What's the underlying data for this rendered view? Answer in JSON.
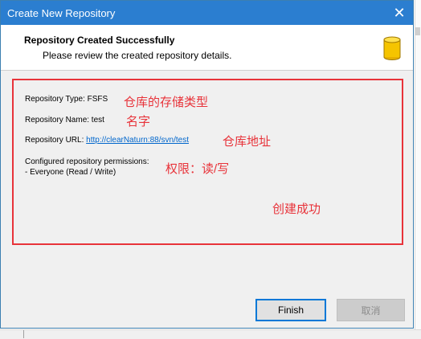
{
  "window": {
    "title": "Create New Repository",
    "close_glyph": "✕"
  },
  "header": {
    "title": "Repository Created Successfully",
    "subtitle": "Please review the created repository details."
  },
  "details": {
    "type_label": "Repository Type: FSFS",
    "name_label": "Repository Name: test",
    "url_prefix": "Repository URL: ",
    "url": "http://clearNaturn:88/svn/test",
    "permissions_title": "Configured repository permissions:",
    "permissions_value": "- Everyone (Read / Write)"
  },
  "annotations": {
    "type_note": "仓库的存储类型",
    "name_note": "名字",
    "url_note": "仓库地址",
    "perm_note": "权限：读/写",
    "success_note": "创建成功"
  },
  "buttons": {
    "finish": "Finish",
    "cancel": "取消"
  },
  "colors": {
    "titlebar": "#2b7ed0",
    "annotation_red": "#e8333a",
    "link_blue": "#0066cc",
    "db_icon_yellow": "#f5c400"
  }
}
